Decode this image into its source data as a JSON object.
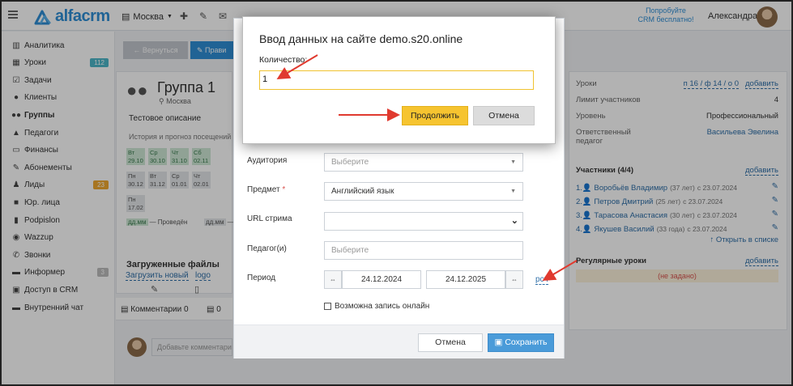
{
  "colors": {
    "brand": "#2f8fd6",
    "accent_yellow": "#f6c430",
    "save_blue": "#4a9bd9",
    "annotation_arrow": "#e03a2f"
  },
  "topbar": {
    "logo": "alfacrm",
    "branch": "Москва",
    "branch_icon": "building-icon",
    "icons": [
      "plus-icon",
      "wrench-icon",
      "envelope-icon",
      "phone-icon",
      "filter-icon",
      "search-icon"
    ],
    "promo_line1": "Попробуйте",
    "promo_line2": "CRM бесплатно!",
    "user_name": "Александра"
  },
  "sidebar": {
    "items": [
      {
        "label": "Аналитика",
        "icon": "analytics-icon",
        "glyph": "▥"
      },
      {
        "label": "Уроки",
        "icon": "calendar-icon",
        "glyph": "▦",
        "badge": "112",
        "badge_color": "#4cb6c9"
      },
      {
        "label": "Задачи",
        "icon": "tasks-icon",
        "glyph": "☑"
      },
      {
        "label": "Клиенты",
        "icon": "user-icon",
        "glyph": "●"
      },
      {
        "label": "Группы",
        "icon": "users-icon",
        "glyph": "●●",
        "active": true
      },
      {
        "label": "Педагоги",
        "icon": "graduation-icon",
        "glyph": "▲"
      },
      {
        "label": "Финансы",
        "icon": "money-icon",
        "glyph": "▭"
      },
      {
        "label": "Абонементы",
        "icon": "ticket-icon",
        "glyph": "✎"
      },
      {
        "label": "Лиды",
        "icon": "lead-icon",
        "glyph": "♟",
        "badge": "23",
        "badge_color": "#f0a830"
      },
      {
        "label": "Юр. лица",
        "icon": "briefcase-icon",
        "glyph": "■"
      },
      {
        "label": "Podpislon",
        "icon": "document-icon",
        "glyph": "▮"
      },
      {
        "label": "Wazzup",
        "icon": "chat-icon",
        "glyph": "◉"
      },
      {
        "label": "Звонки",
        "icon": "phone-icon",
        "glyph": "✆"
      },
      {
        "label": "Информер",
        "icon": "inbox-icon",
        "glyph": "▬",
        "badge": "3",
        "badge_color": "#bdbdbd"
      },
      {
        "label": "Доступ в CRM",
        "icon": "lock-icon",
        "glyph": "▣"
      },
      {
        "label": "Внутренний чат",
        "icon": "message-icon",
        "glyph": "▬"
      }
    ]
  },
  "main": {
    "back_label": "← Вернуться",
    "edit_label": "✎ Прави",
    "group_title": "Группа 1",
    "group_city": "Москва",
    "description": "Тестовое описание",
    "history_title": "История и прогноз посещений",
    "dates_row1": [
      {
        "day": "Вт",
        "date": "29.10"
      },
      {
        "day": "Ср",
        "date": "30.10"
      },
      {
        "day": "Чт",
        "date": "31.10"
      },
      {
        "day": "Сб",
        "date": "02.11"
      }
    ],
    "dates_row2": [
      {
        "day": "Пн",
        "date": "30.12"
      },
      {
        "day": "Вт",
        "date": "31.12"
      },
      {
        "day": "Ср",
        "date": "01.01"
      },
      {
        "day": "Чт",
        "date": "02.01"
      }
    ],
    "dates_row3": [
      {
        "day": "Пн",
        "date": "17.02"
      }
    ],
    "legend_past_swatch": "дд.мм",
    "legend_past": "— Проведён",
    "legend_future_swatch": "дд.мм",
    "legend_future": "— ",
    "files_title": "Загруженные файлы",
    "upload_link": "Загрузить новый",
    "file_link": "logo",
    "comments_tab": "Комментарии 0",
    "tasks_tab": "0",
    "comment_placeholder": "Добавьте комментарий"
  },
  "right_panel": {
    "lessons_label": "Уроки",
    "lessons_value": "п 16 / ф 14 / о 0",
    "add_label": "добавить",
    "limit_label": "Лимит участников",
    "limit_value": "4",
    "level_label": "Уровень",
    "level_value": "Профессиональный",
    "teacher_label_line1": "Ответственный",
    "teacher_label_line2": "педагог",
    "teacher_value": "Васильева Эвелина",
    "participants_title": "Участники (4/4)",
    "participants": [
      {
        "name": "1.👤 Воробьёв Владимир",
        "age": "(37 лет)",
        "since": "с 23.07.2024"
      },
      {
        "name": "2.👤 Петров Дмитрий",
        "age": "(25 лет)",
        "since": "с 23.07.2024"
      },
      {
        "name": "3.👤 Тарасова Анастасия",
        "age": "(30 лет)",
        "since": "с 23.07.2024"
      },
      {
        "name": "4.👤 Якушев Василий",
        "age": "(33 года)",
        "since": "с 23.07.2024"
      }
    ],
    "open_list": "↑ Открыть в списке",
    "regular_title": "Регулярные уроки",
    "not_set": "(не задано)"
  },
  "form": {
    "room_label": "Аудитория",
    "room_placeholder": "Выберите",
    "subject_label": "Предмет",
    "subject_required": "*",
    "subject_value": "Английский язык",
    "stream_label": "URL стрима",
    "teacher_label": "Педагог(и)",
    "teacher_placeholder": "Выберите",
    "period_label": "Период",
    "date_start": "24.12.2024",
    "date_end": "24.12.2025",
    "rsch_link": "рсч",
    "online_label": "Возможна запись онлайн",
    "cancel_label": "Отмена",
    "save_label": "Сохранить"
  },
  "dialog": {
    "title": "Ввод данных на сайте demo.s20.online",
    "field_label": "Количество:",
    "field_value": "1",
    "ok_label": "Продолжить",
    "cancel_label": "Отмена"
  }
}
